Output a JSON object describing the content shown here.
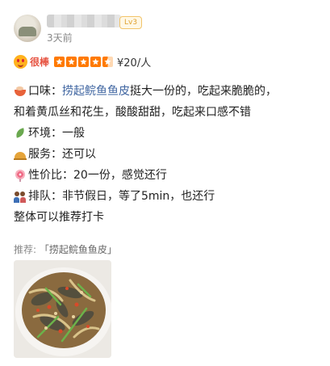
{
  "header": {
    "level_badge": "Lv3",
    "time_ago": "3天前"
  },
  "rating": {
    "label": "很棒",
    "stars": 4.5,
    "price": "¥20/人"
  },
  "review": {
    "taste_label": "口味：",
    "dish_name": "捞起鲩鱼鱼皮",
    "taste_text_1": "挺大一份的，吃起来脆脆的，",
    "taste_text_2": "和着黄瓜丝和花生，酸酸甜甜，吃起来口感不错",
    "environment": "环境：一般",
    "service": "服务：还可以",
    "value": "性价比：20一份，感觉还行",
    "queue": "排队：非节假日，等了5min，也还行",
    "closing": "整体可以推荐打卡"
  },
  "recommend": {
    "label": "推荐:",
    "tag": "「捞起鲩鱼鱼皮」"
  },
  "colors": {
    "rating_red": "#e6513f",
    "star_orange": "#ff7a00",
    "link_blue": "#3e64a0"
  }
}
